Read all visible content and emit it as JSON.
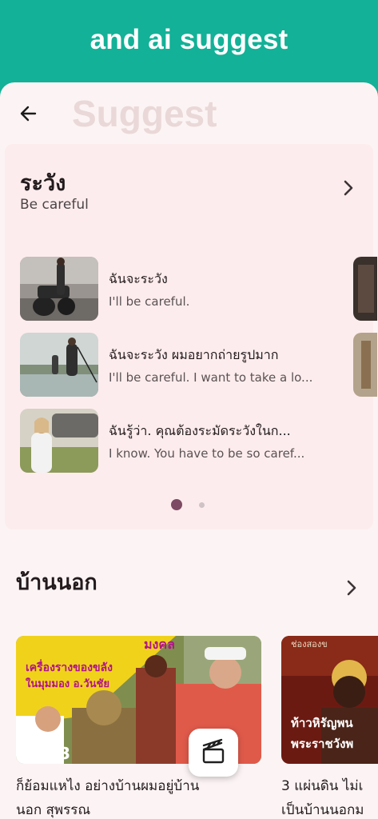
{
  "banner": {
    "title": "and ai suggest"
  },
  "header": {
    "title": "Suggest"
  },
  "suggest_card": {
    "title": "ระวัง",
    "subtitle": "Be careful",
    "items": [
      {
        "thai": "ฉันจะระวัง",
        "english": "I'll be careful."
      },
      {
        "thai": "ฉันจะระวัง ผมอยากถ่ายรูปมาก",
        "english": "I'll be careful. I want to take a lo..."
      },
      {
        "thai": "ฉันรู้ว่า. คุณต้องระมัดระวังในก...",
        "english": "I know. You have to be so caref..."
      }
    ],
    "page_index": 1,
    "page_count": 2
  },
  "section": {
    "title": "บ้านนอก",
    "videos": [
      {
        "poster_text_top": "มงคล",
        "poster_text_line1": "เครื่องรางของขลัง",
        "poster_text_line2": "ในมุมมอง อ.วันชัย",
        "episode": "EP.13",
        "caption_line1": "ก็ย้อมแหไง อย่างบ้านผมอยู่บ้าน",
        "caption_line2": "นอก สุพรรณ"
      },
      {
        "poster_text_top": "ช่องสองข",
        "poster_text_line1": "ท้าวหิรัญพน",
        "poster_text_line2": "พระราชวังพ",
        "caption_line1": "3 แผ่นดิน ไม่เ",
        "caption_line2": "เป็นบ้านนอกม"
      }
    ]
  },
  "colors": {
    "brand": "#13b197",
    "page_bg": "#fcf4f4",
    "card_bg": "#fdeced",
    "dot_active": "#7d4b63",
    "dot_inactive": "#cfc3c6"
  },
  "icons": {
    "back": "arrow-left-icon",
    "chevron": "chevron-right-icon",
    "fab": "clapperboard-icon"
  }
}
